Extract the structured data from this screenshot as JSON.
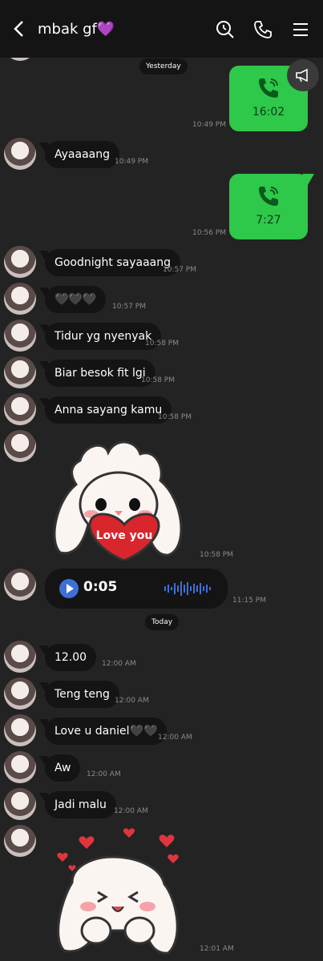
{
  "header": {
    "title": "mbak gf💜"
  },
  "dates": {
    "yesterday": "Yesterday",
    "today": "Today"
  },
  "calls": [
    {
      "duration": "16:02",
      "time": "10:49 PM"
    },
    {
      "duration": "7:27",
      "time": "10:56 PM"
    }
  ],
  "messages": [
    {
      "text": "Ayaaaang",
      "time": "10:49 PM"
    },
    {
      "text": "Goodnight sayaaang",
      "time": "10:57 PM"
    },
    {
      "text": "🖤🖤🖤",
      "time": "10:57 PM"
    },
    {
      "text": "Tidur yg nyenyak",
      "time": "10:58 PM"
    },
    {
      "text": "Biar besok fit lgi",
      "time": "10:58 PM"
    },
    {
      "text": "Anna sayang kamu",
      "time": "10:58 PM"
    },
    {
      "text": "12.00",
      "time": "12:00 AM"
    },
    {
      "text": "Teng teng",
      "time": "12:00 AM"
    },
    {
      "text": "Love u daniel🖤🖤",
      "time": "12:00 AM"
    },
    {
      "text": "Aw",
      "time": "12:00 AM"
    },
    {
      "text": "Jadi malu",
      "time": "12:00 AM"
    }
  ],
  "stickers": [
    {
      "caption": "Love you",
      "time": "10:58 PM"
    },
    {
      "time": "12:01 AM"
    }
  ],
  "voice": {
    "length": "0:05",
    "time": "11:15 PM"
  },
  "colors": {
    "call": "#2ec84a",
    "bubble": "#141414",
    "background": "#232323",
    "voice_accent": "#3d6fd9"
  }
}
